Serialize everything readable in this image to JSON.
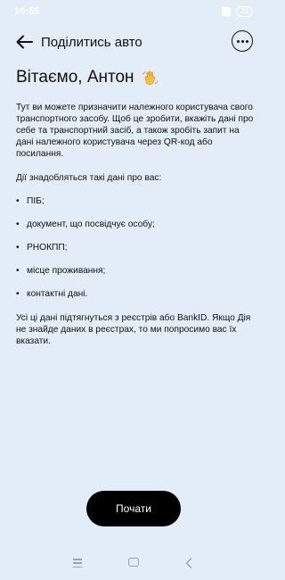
{
  "status_bar": {
    "time": "10:55",
    "battery": "24"
  },
  "header": {
    "title": "Поділитись авто"
  },
  "greeting": {
    "text": "Вітаємо, Антон"
  },
  "content": {
    "intro": "Тут ви можете призначити належного користувача свого транспортного засобу. Щоб це зробити, вкажіть дані про себе та транспортний засіб, а також зробіть запит на дані належного користувача через QR-код або посилання.",
    "need_label": "Дії знадобляться такі дані про вас:",
    "bullets": [
      "ПІБ;",
      "документ, що посвідчує особу;",
      "РНОКПП;",
      "місце проживання;",
      "контактні дані."
    ],
    "footer": "Усі ці дані підтягнуться з реєстрів або BankID. Якщо Дія не знайде даних в реєстрах, то ми попросимо вас їх вказати."
  },
  "actions": {
    "start_label": "Почати"
  },
  "icons": {
    "back": "arrow-left-icon",
    "more": "more-dots-icon",
    "wave": "waving-hand-icon"
  }
}
